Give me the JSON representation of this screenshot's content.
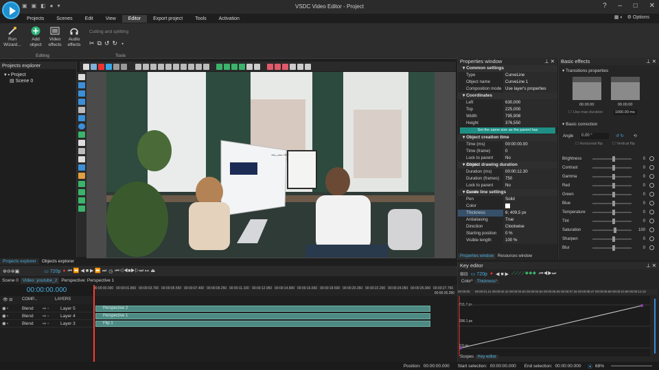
{
  "app": {
    "title": "VSDC Video Editor - Project",
    "options_label": "Options"
  },
  "menu": [
    "Projects",
    "Scenes",
    "Edit",
    "View",
    "Editor",
    "Export project",
    "Tools",
    "Activation"
  ],
  "ribbon": {
    "run_wizard": "Run Wizard...",
    "add_object": "Add object",
    "video_effects": "Video effects",
    "audio_effects": "Audio effects",
    "cutting": "Cutting and splitting",
    "editing_label": "Editing",
    "tools_label": "Tools"
  },
  "projects_explorer": {
    "title": "Projects explorer",
    "root": "Project",
    "child": "Scene 0"
  },
  "properties": {
    "title": "Properties window",
    "common_settings": "Common settings",
    "type_label": "Type",
    "type_value": "CurveLine",
    "object_name_label": "Object name",
    "object_name_value": "CurveLine 1",
    "composition_label": "Composition mode",
    "composition_value": "Use layer's properties",
    "coordinates": "Coordinates",
    "left_label": "Left",
    "left_value": "630,000",
    "top_label": "Top",
    "top_value": "225,000",
    "width_label": "Width",
    "width_value": "795,908",
    "height_label": "Height",
    "height_value": "376,550",
    "same_size_button": "Set the same size as the parent has",
    "creation_time": "Object creation time",
    "time_ms_label": "Time (ms)",
    "time_ms_value": "00:00:00.00",
    "time_frame_label": "Time (frame)",
    "time_frame_value": "0",
    "lock_parent_label": "Lock to parent duratic",
    "lock_parent_value": "No",
    "drawing_duration": "Object drawing duration",
    "duration_ms_label": "Duration (ms)",
    "duration_ms_value": "00:00:12.30",
    "duration_frames_label": "Duration (frames)",
    "duration_frames_value": "750",
    "lock_parent2_label": "Lock to parent duratic",
    "lock_parent2_value": "No",
    "curve_settings": "Curve line settings",
    "pen_label": "Pen",
    "pen_value": "Solid",
    "color_label": "Color",
    "thickness_label": "Thickness",
    "thickness_value": "6; 409,5 px",
    "antialiasing_label": "Antialiasing",
    "antialiasing_value": "True",
    "direction_label": "Direction",
    "direction_value": "Clockwise",
    "starting_pos_label": "Starting position",
    "starting_pos_value": "0 %",
    "visible_len_label": "Visible length",
    "visible_len_value": "100 %",
    "tab_properties": "Properties window",
    "tab_resources": "Resources window"
  },
  "basic_effects": {
    "title": "Basic effects",
    "transitions": "Transitions properties",
    "time_a": "00.00.00",
    "time_b": "00.00.00",
    "use_max": "Use max duration",
    "duration_value": "1000.00 ms",
    "basic_correction": "Basic correction",
    "angle_label": "Angle",
    "angle_value": "0.00 °",
    "horizontal_flip": "Horizontal flip",
    "vertical_flip": "Vertical flip",
    "sliders": [
      {
        "label": "Brightness",
        "value": "0",
        "pos": 0.5
      },
      {
        "label": "Contrast",
        "value": "0",
        "pos": 0.5
      },
      {
        "label": "Gamma",
        "value": "0",
        "pos": 0.5
      },
      {
        "label": "Red",
        "value": "0",
        "pos": 0.5
      },
      {
        "label": "Green",
        "value": "0",
        "pos": 0.5
      },
      {
        "label": "Blue",
        "value": "0",
        "pos": 0.5
      },
      {
        "label": "Temperature",
        "value": "0",
        "pos": 0.5
      },
      {
        "label": "Tint",
        "value": "0",
        "pos": 0.5
      },
      {
        "label": "Saturation",
        "value": "100",
        "pos": 0.55
      },
      {
        "label": "Sharpen",
        "value": "0",
        "pos": 0.5
      },
      {
        "label": "Blur",
        "value": "0",
        "pos": 0.5
      }
    ]
  },
  "left_tabs": {
    "projects": "Projects explorer",
    "objects": "Objects explorer"
  },
  "timeline": {
    "quality": "720p",
    "tabs": [
      "Scene 0",
      "Video: youtube_2",
      "Perspective: Perspective 1"
    ],
    "timecode": "00:00:00.000",
    "ruler": [
      "00:00:00.000",
      "00:00:01.850",
      "00:00:03.700",
      "00:00:05.550",
      "00:00:07.400",
      "00:00:09.250",
      "00:00:11.100",
      "00:00:12.950",
      "00:00:14.800",
      "00:00:16.650",
      "00:00:18.500",
      "00:00:20.350",
      "00:00:22.200",
      "00:00:24.050",
      "00:00:25.900",
      "00:00:27.750"
    ],
    "ruler_end": "00:00:26.280",
    "header_comp": "COMP...",
    "header_layers": "LAYERS",
    "tracks": [
      {
        "blend": "Blend",
        "layer": "Layer 5",
        "clip": "Perspective 2"
      },
      {
        "blend": "Blend",
        "layer": "Layer 4",
        "clip": "Perspective 1"
      },
      {
        "blend": "Blend",
        "layer": "Layer 3",
        "clip": "Flip 1"
      }
    ]
  },
  "key_editor": {
    "title": "Key editor",
    "tab_color": "Color*",
    "tab_thickness": "Thickness*",
    "quality": "720p",
    "ruler": [
      "00:00:00",
      "00:00:01.21",
      "00:00:02.42",
      "00:00:03.63",
      "00:00:04.84",
      "00:00:06.05",
      "00:00:07.26",
      "00:00:08.47",
      "00:00:09.68",
      "00:00:10.89",
      "00:00:12.10"
    ],
    "y_top": "411.7 px",
    "y_mid": "206.1 px",
    "y_bot": "0.5 px",
    "tab_scopes": "Scopes",
    "tab_key_editor": "Key editor"
  },
  "status": {
    "position_label": "Position:",
    "position_value": "00:00:00.000",
    "start_sel_label": "Start selection:",
    "start_sel_value": "00:00:00.000",
    "end_sel_label": "End selection:",
    "end_sel_value": "00:00:00.000",
    "zoom": "68%"
  },
  "colors": {
    "accent": "#1f8f86",
    "clip": "#4c8a83",
    "playhead": "#ff3b30",
    "key_line": "#cfcfcf"
  },
  "preview_screen": {
    "title": "ایجاد بستر رشد"
  }
}
